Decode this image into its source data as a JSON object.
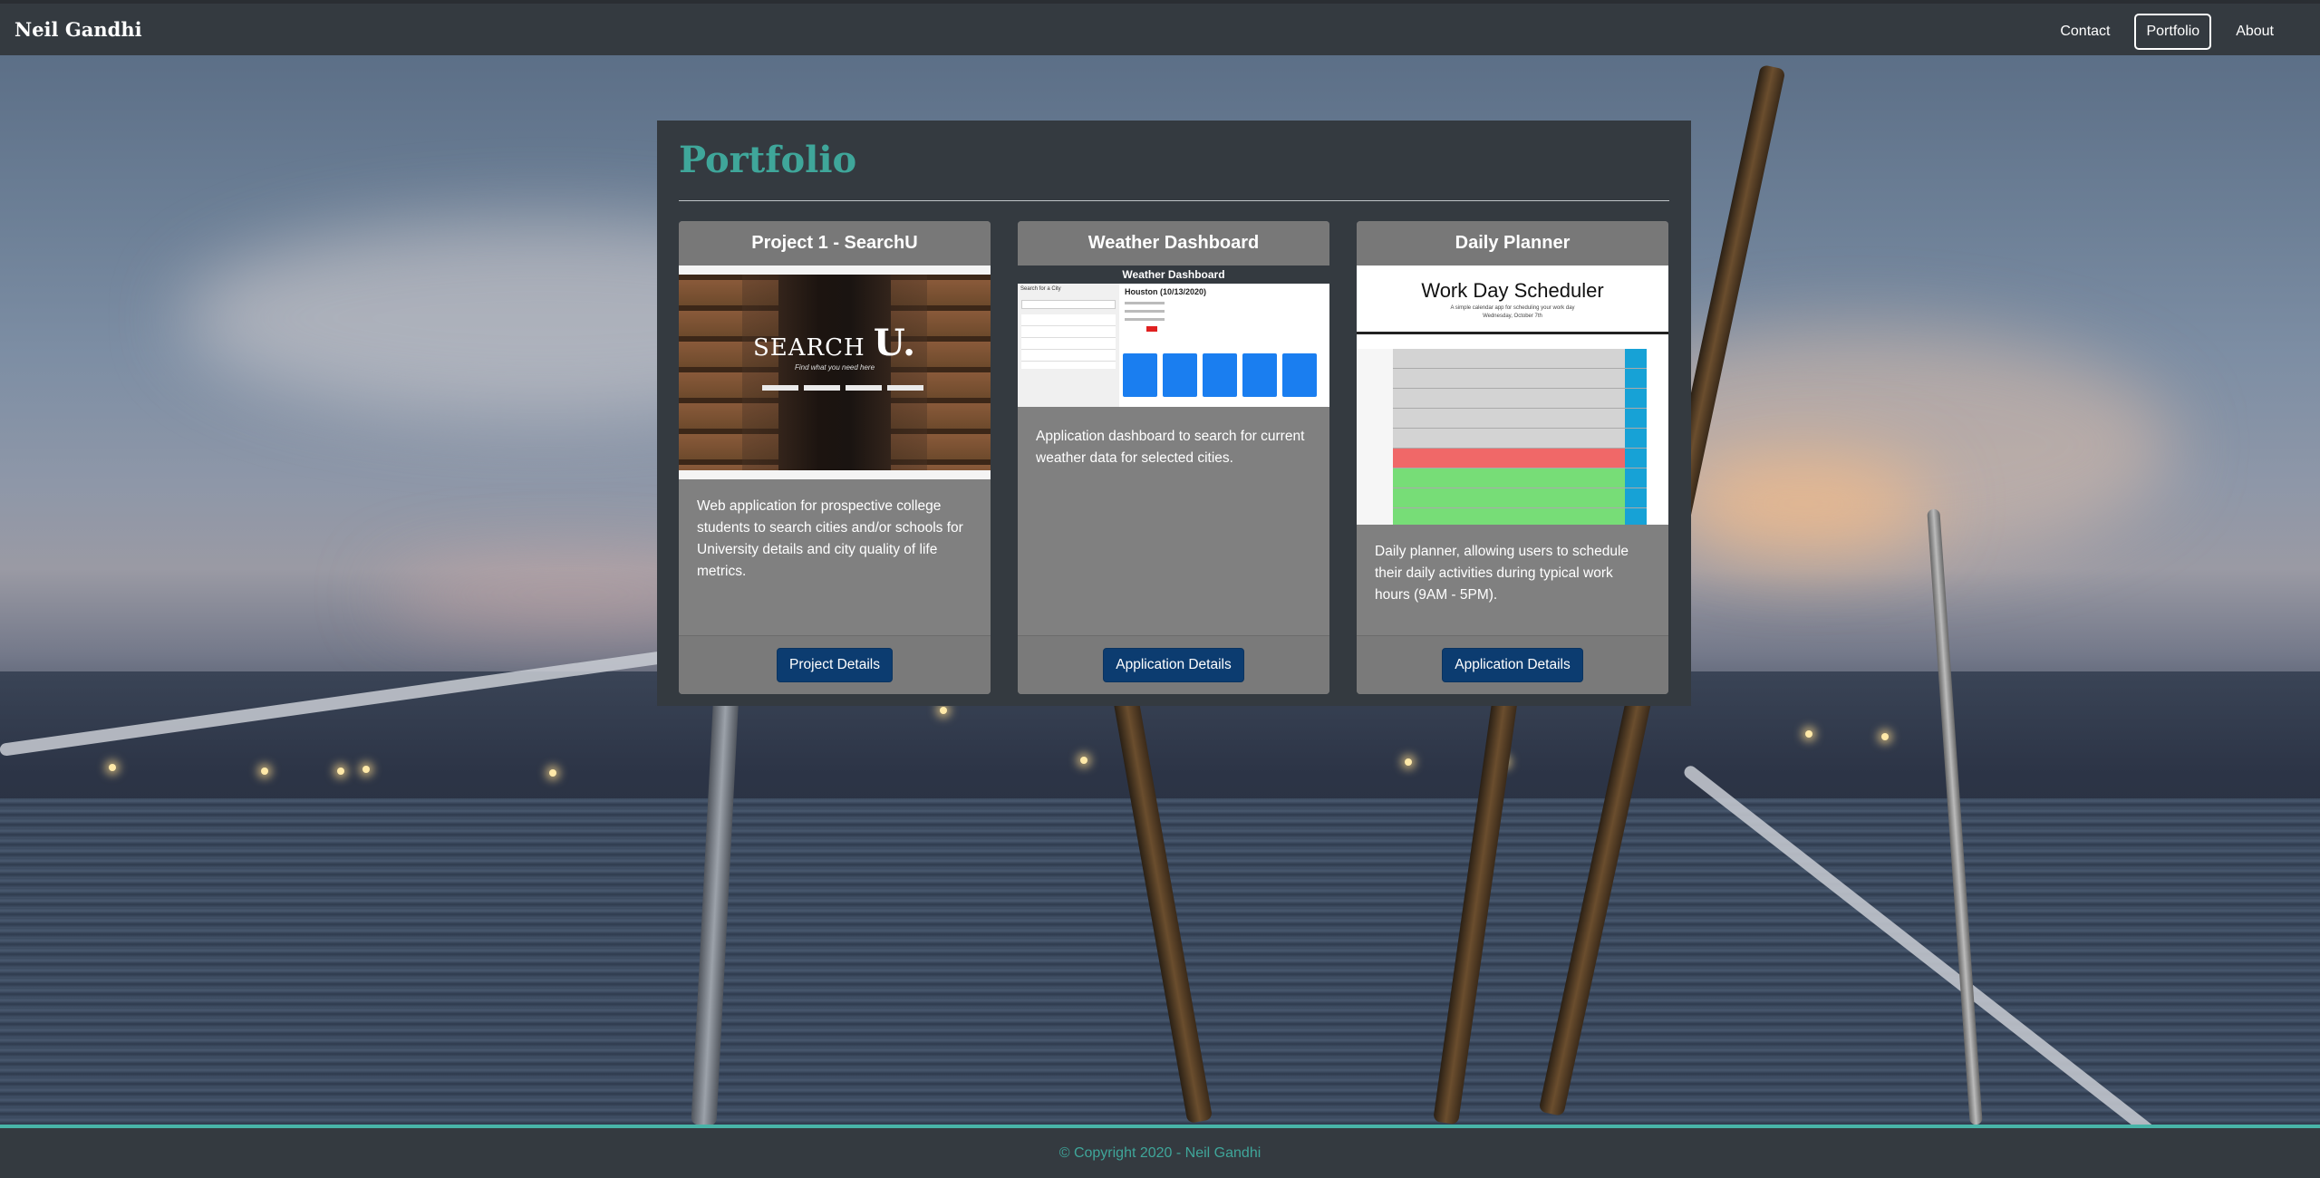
{
  "navbar": {
    "brand": "Neil Gandhi",
    "links": [
      "Contact",
      "Portfolio",
      "About"
    ],
    "active": "Portfolio"
  },
  "portfolio": {
    "title": "Portfolio",
    "cards": [
      {
        "title": "Project 1 - SearchU",
        "description": "Web application for prospective college students to search cities and/or schools for University details and city quality of life metrics.",
        "button": "Project Details",
        "thumb_logo": "SEARCH",
        "thumb_logo_letter": "U.",
        "thumb_tagline": "Find what you need here"
      },
      {
        "title": "Weather Dashboard",
        "description": "Application dashboard to search for current weather data for selected cities.",
        "button": "Application Details",
        "thumb_header": "Weather Dashboard",
        "thumb_city": "Houston (10/13/2020)",
        "thumb_search": "Search for a City"
      },
      {
        "title": "Daily Planner",
        "description": "Daily planner, allowing users to schedule their daily activities during typical work hours (9AM - 5PM).",
        "button": "Application Details",
        "thumb_heading": "Work Day Scheduler",
        "thumb_subheading": "A simple calendar app for scheduling your work day",
        "thumb_date": "Wednesday, October 7th"
      }
    ]
  },
  "footer": {
    "copyright": "© Copyright 2020 - Neil Gandhi"
  },
  "colors": {
    "navbar_bg": "#343a40",
    "accent_teal": "#3fa69a",
    "card_bg": "#808080",
    "button_bg": "#0c3c70"
  }
}
